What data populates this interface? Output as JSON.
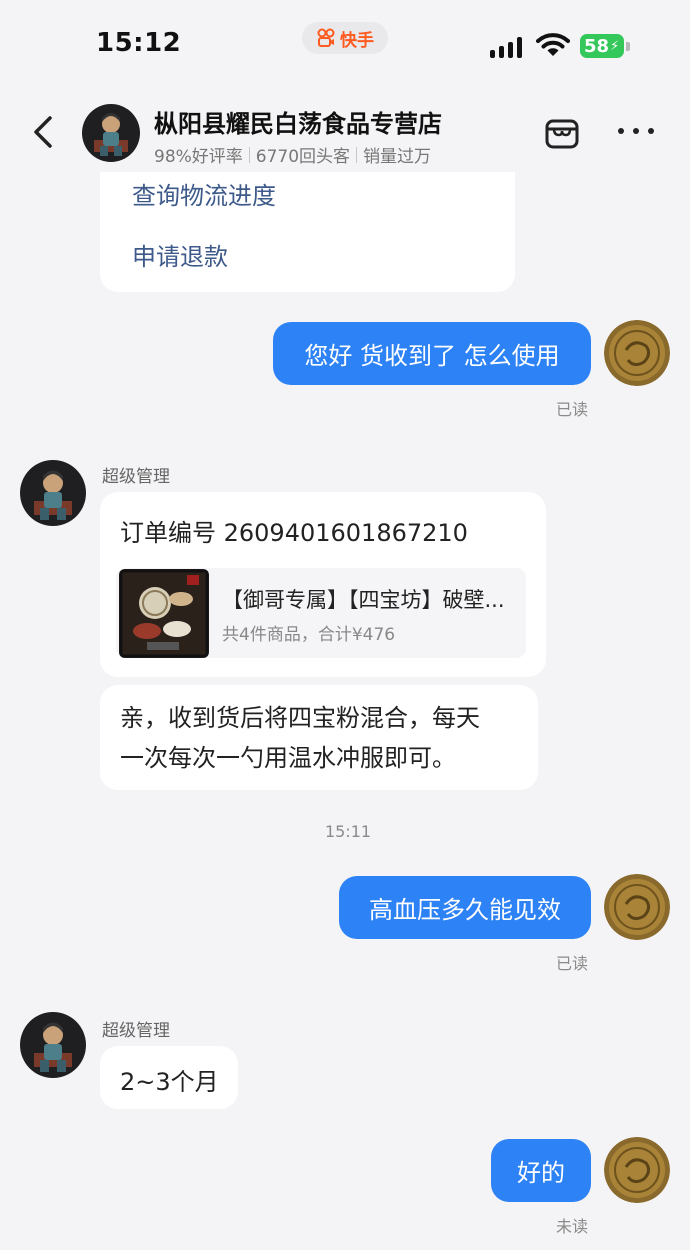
{
  "status_bar": {
    "time": "15:12",
    "app_name": "快手",
    "battery": "58"
  },
  "header": {
    "shop_name": "枞阳县耀民白荡食品专营店",
    "good_rate": "98%好评率",
    "repeat_customers": "6770回头客",
    "sales": "销量过万"
  },
  "options": {
    "track_logistics": "查询物流进度",
    "request_refund": "申请退款"
  },
  "messages": {
    "m1": {
      "text": "您好 货收到了 怎么使用",
      "status": "已读"
    },
    "sender1": "超级管理",
    "order": {
      "number_label": "订单编号 2609401601867210",
      "product_title": "【御哥专属】【四宝坊】破壁...",
      "product_summary": "共4件商品，合计¥476"
    },
    "m2": {
      "text_line1": "亲，收到货后将四宝粉混合，每天",
      "text_line2": "一次每次一勺用温水冲服即可。"
    },
    "timestamp": "15:11",
    "m3": {
      "text": "高血压多久能见效",
      "status": "已读"
    },
    "sender2": "超级管理",
    "m4": {
      "text": "2~3个月"
    },
    "m5": {
      "text": "好的",
      "status": "未读"
    }
  },
  "colors": {
    "accent_blue": "#2d82f5",
    "link_blue": "#3e5a8a",
    "battery_green": "#34c759",
    "brand_orange": "#ff5a1f"
  }
}
